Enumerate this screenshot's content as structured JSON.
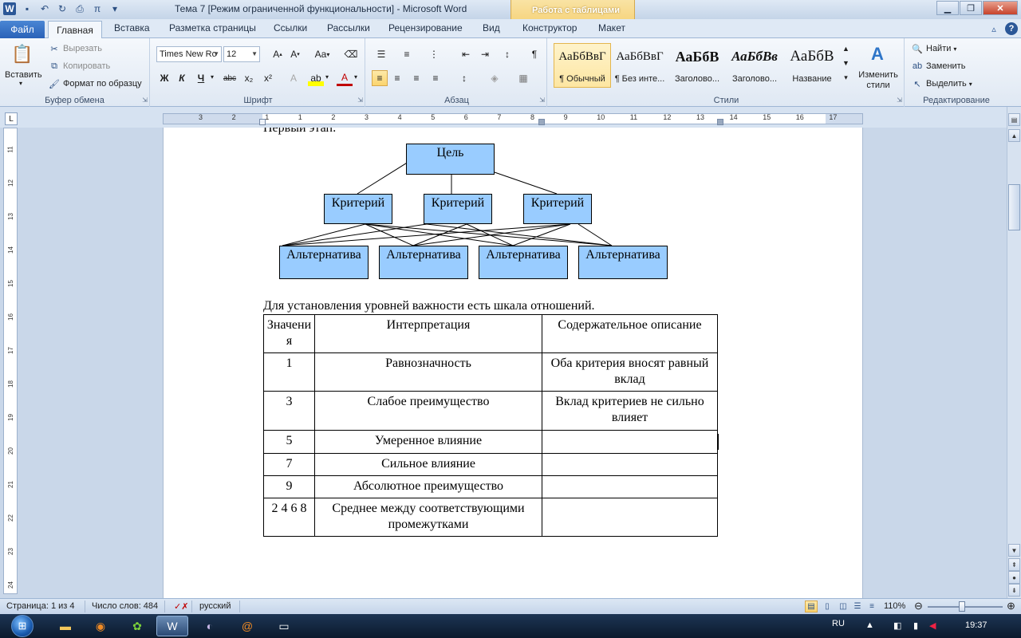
{
  "window": {
    "title": "Тема 7 [Режим ограниченной функциональности]  -  Microsoft Word",
    "context_group": "Работа с таблицами",
    "icons": [
      "word-icon",
      "save-icon",
      "undo-icon",
      "redo-icon",
      "print-icon",
      "pi-icon",
      "customize-qat-icon"
    ]
  },
  "tabs": {
    "file": "Файл",
    "items": [
      "Главная",
      "Вставка",
      "Разметка страницы",
      "Ссылки",
      "Рассылки",
      "Рецензирование",
      "Вид",
      "Конструктор",
      "Макет"
    ],
    "active": "Главная"
  },
  "ribbon": {
    "clipboard": {
      "paste": "Вставить",
      "cut": "Вырезать",
      "copy": "Копировать",
      "format_painter": "Формат по образцу",
      "label": "Буфер обмена"
    },
    "font": {
      "name": "Times New Ro",
      "size": "12",
      "label": "Шрифт",
      "bold": "Ж",
      "italic": "К",
      "underline": "Ч",
      "strike": "abc",
      "case": "Aa"
    },
    "paragraph": {
      "label": "Абзац"
    },
    "styles": {
      "label": "Стили",
      "items": [
        {
          "sample": "АаБбВвГ",
          "name": "¶ Обычный",
          "selected": true
        },
        {
          "sample": "АаБбВвГ",
          "name": "¶ Без инте...",
          "selected": false
        },
        {
          "sample": "АаБбВ",
          "name": "Заголово...",
          "selected": false
        },
        {
          "sample": "АаБбВв",
          "name": "Заголово...",
          "selected": false
        },
        {
          "sample": "АаБбВ",
          "name": "Название",
          "selected": false
        }
      ],
      "change_styles": "Изменить стили"
    },
    "editing": {
      "label": "Редактирование",
      "find": "Найти",
      "replace": "Заменить",
      "select": "Выделить"
    }
  },
  "ruler": {
    "numbers": [
      "3",
      "2",
      "1",
      "1",
      "2",
      "3",
      "4",
      "5",
      "6",
      "7",
      "8",
      "9",
      "10",
      "11",
      "12",
      "13",
      "14",
      "15",
      "16",
      "17"
    ],
    "vertical_numbers": [
      "11",
      "12",
      "13",
      "14",
      "15",
      "16",
      "17",
      "18",
      "19",
      "20",
      "21",
      "22",
      "23",
      "24"
    ]
  },
  "document": {
    "previous_line": "Первый этап:",
    "diagram": {
      "goal": "Цель",
      "criteria": [
        "Критерий",
        "Критерий",
        "Критерий"
      ],
      "alternatives": [
        "Альтернатива",
        "Альтернатива",
        "Альтернатива",
        "Альтернатива"
      ]
    },
    "intro": "Для установления уровней важности есть шкала отношений.",
    "table": {
      "headers": [
        "Значения",
        "Интерпретация",
        "Содержательное описание"
      ],
      "rows": [
        [
          "1",
          "Равнозначность",
          "Оба критерия вносят равный вклад"
        ],
        [
          "3",
          "Слабое преимущество",
          "Вклад критериев не сильно влияет"
        ],
        [
          "5",
          "Умеренное влияние",
          ""
        ],
        [
          "7",
          "Сильное влияние",
          ""
        ],
        [
          "9",
          "Абсолютное преимущество",
          ""
        ],
        [
          "2 4 6 8",
          "Среднее между соответствующими промежутками",
          ""
        ]
      ]
    }
  },
  "status_bar": {
    "page": "Страница: 1 из 4",
    "words": "Число слов: 484",
    "language": "русский",
    "zoom": "110%",
    "zoom_level": 0.46
  },
  "taskbar": {
    "lang": "RU",
    "time": "19:37",
    "apps": [
      "explorer-icon",
      "firefox-icon",
      "icq-icon",
      "word-icon",
      "eclipse-icon",
      "mail-agent-icon",
      "window-icon"
    ]
  }
}
